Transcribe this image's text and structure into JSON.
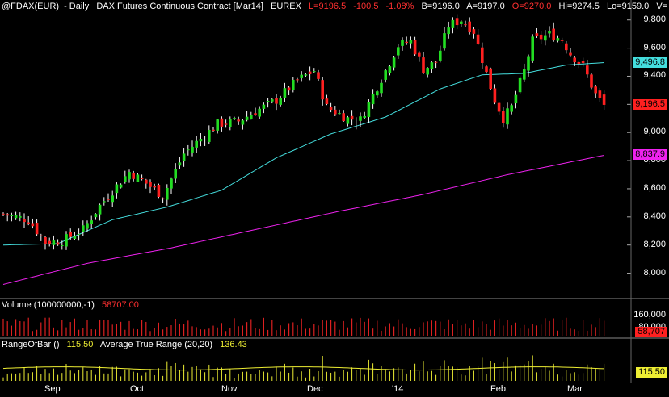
{
  "header": {
    "symbol": "@FDAX(EUR)",
    "interval": "Daily",
    "description": "DAX  Futures Continuous Contract [Mar14]",
    "exchange": "EUREX",
    "last": "L=9196.5",
    "change": "-100.5",
    "change_pct": "-1.08%",
    "bid": "B=9196.0",
    "ask": "A=9197.0",
    "open": "O=9270.0",
    "high": "Hi=9274.5",
    "low": "Lo=9159.0",
    "volume_prefix": "V="
  },
  "volume_panel": {
    "title": "Volume (100000000,-1)",
    "value": "58707.00",
    "ticks": [
      "160,000",
      "80,000"
    ],
    "badge": "58,707"
  },
  "range_panel": {
    "title": "RangeOfBar ()",
    "value": "115.50",
    "atr_title": "Average True Range (20,20)",
    "atr_value": "136.43",
    "badge": "115.50"
  },
  "price_axis": {
    "ticks": [
      "9,800",
      "9,600",
      "9,400",
      "9,200",
      "9,000",
      "8,800",
      "8,600",
      "8,400",
      "8,200",
      "8,000"
    ],
    "badge_ma_short": "9,496.8",
    "badge_last": "9,196.5",
    "badge_ma_long": "8,837.9"
  },
  "colors": {
    "up": "#22dd22",
    "down": "#ff2020",
    "volume": "#dd2020",
    "range": "#eeee33",
    "atr": "#eeee33",
    "ma_short": "#44dddd",
    "ma_long": "#ee22ee",
    "badge_last": "#ff2020",
    "badge_ma_short": "#44dddd",
    "badge_ma_long": "#ee22ee"
  },
  "chart_data": {
    "type": "candlestick",
    "x_labels": [
      "Sep",
      "Oct",
      "Nov",
      "Dec",
      "'14",
      "Feb",
      "Mar"
    ],
    "ylim": [
      7900,
      9850
    ],
    "anchors": [
      [
        0,
        8420
      ],
      [
        6,
        8380
      ],
      [
        10,
        8220
      ],
      [
        14,
        8230
      ],
      [
        19,
        8310
      ],
      [
        23,
        8480
      ],
      [
        27,
        8620
      ],
      [
        30,
        8720
      ],
      [
        33,
        8660
      ],
      [
        38,
        8550
      ],
      [
        43,
        8850
      ],
      [
        51,
        9060
      ],
      [
        56,
        9080
      ],
      [
        60,
        9150
      ],
      [
        65,
        9230
      ],
      [
        70,
        9370
      ],
      [
        74,
        9440
      ],
      [
        77,
        9180
      ],
      [
        82,
        9100
      ],
      [
        85,
        9090
      ],
      [
        88,
        9270
      ],
      [
        91,
        9440
      ],
      [
        94,
        9620
      ],
      [
        97,
        9650
      ],
      [
        100,
        9450
      ],
      [
        103,
        9500
      ],
      [
        106,
        9760
      ],
      [
        109,
        9800
      ],
      [
        112,
        9720
      ],
      [
        115,
        9420
      ],
      [
        117,
        9230
      ],
      [
        119,
        9100
      ],
      [
        121,
        9180
      ],
      [
        124,
        9440
      ],
      [
        126,
        9650
      ],
      [
        130,
        9700
      ],
      [
        133,
        9660
      ],
      [
        135,
        9560
      ],
      [
        138,
        9470
      ],
      [
        141,
        9270
      ],
      [
        143,
        9196
      ]
    ],
    "ma_short_anchors": [
      [
        0,
        8200
      ],
      [
        13,
        8210
      ],
      [
        26,
        8380
      ],
      [
        39,
        8470
      ],
      [
        52,
        8590
      ],
      [
        65,
        8820
      ],
      [
        78,
        8990
      ],
      [
        91,
        9110
      ],
      [
        104,
        9310
      ],
      [
        114,
        9410
      ],
      [
        124,
        9420
      ],
      [
        134,
        9480
      ],
      [
        143,
        9497
      ]
    ],
    "ma_long_anchors": [
      [
        0,
        7920
      ],
      [
        20,
        8070
      ],
      [
        40,
        8180
      ],
      [
        60,
        8310
      ],
      [
        80,
        8440
      ],
      [
        100,
        8560
      ],
      [
        120,
        8700
      ],
      [
        143,
        8838
      ]
    ],
    "volume_ylim": [
      0,
      180000
    ],
    "range_ylim": [
      0,
      320
    ]
  }
}
